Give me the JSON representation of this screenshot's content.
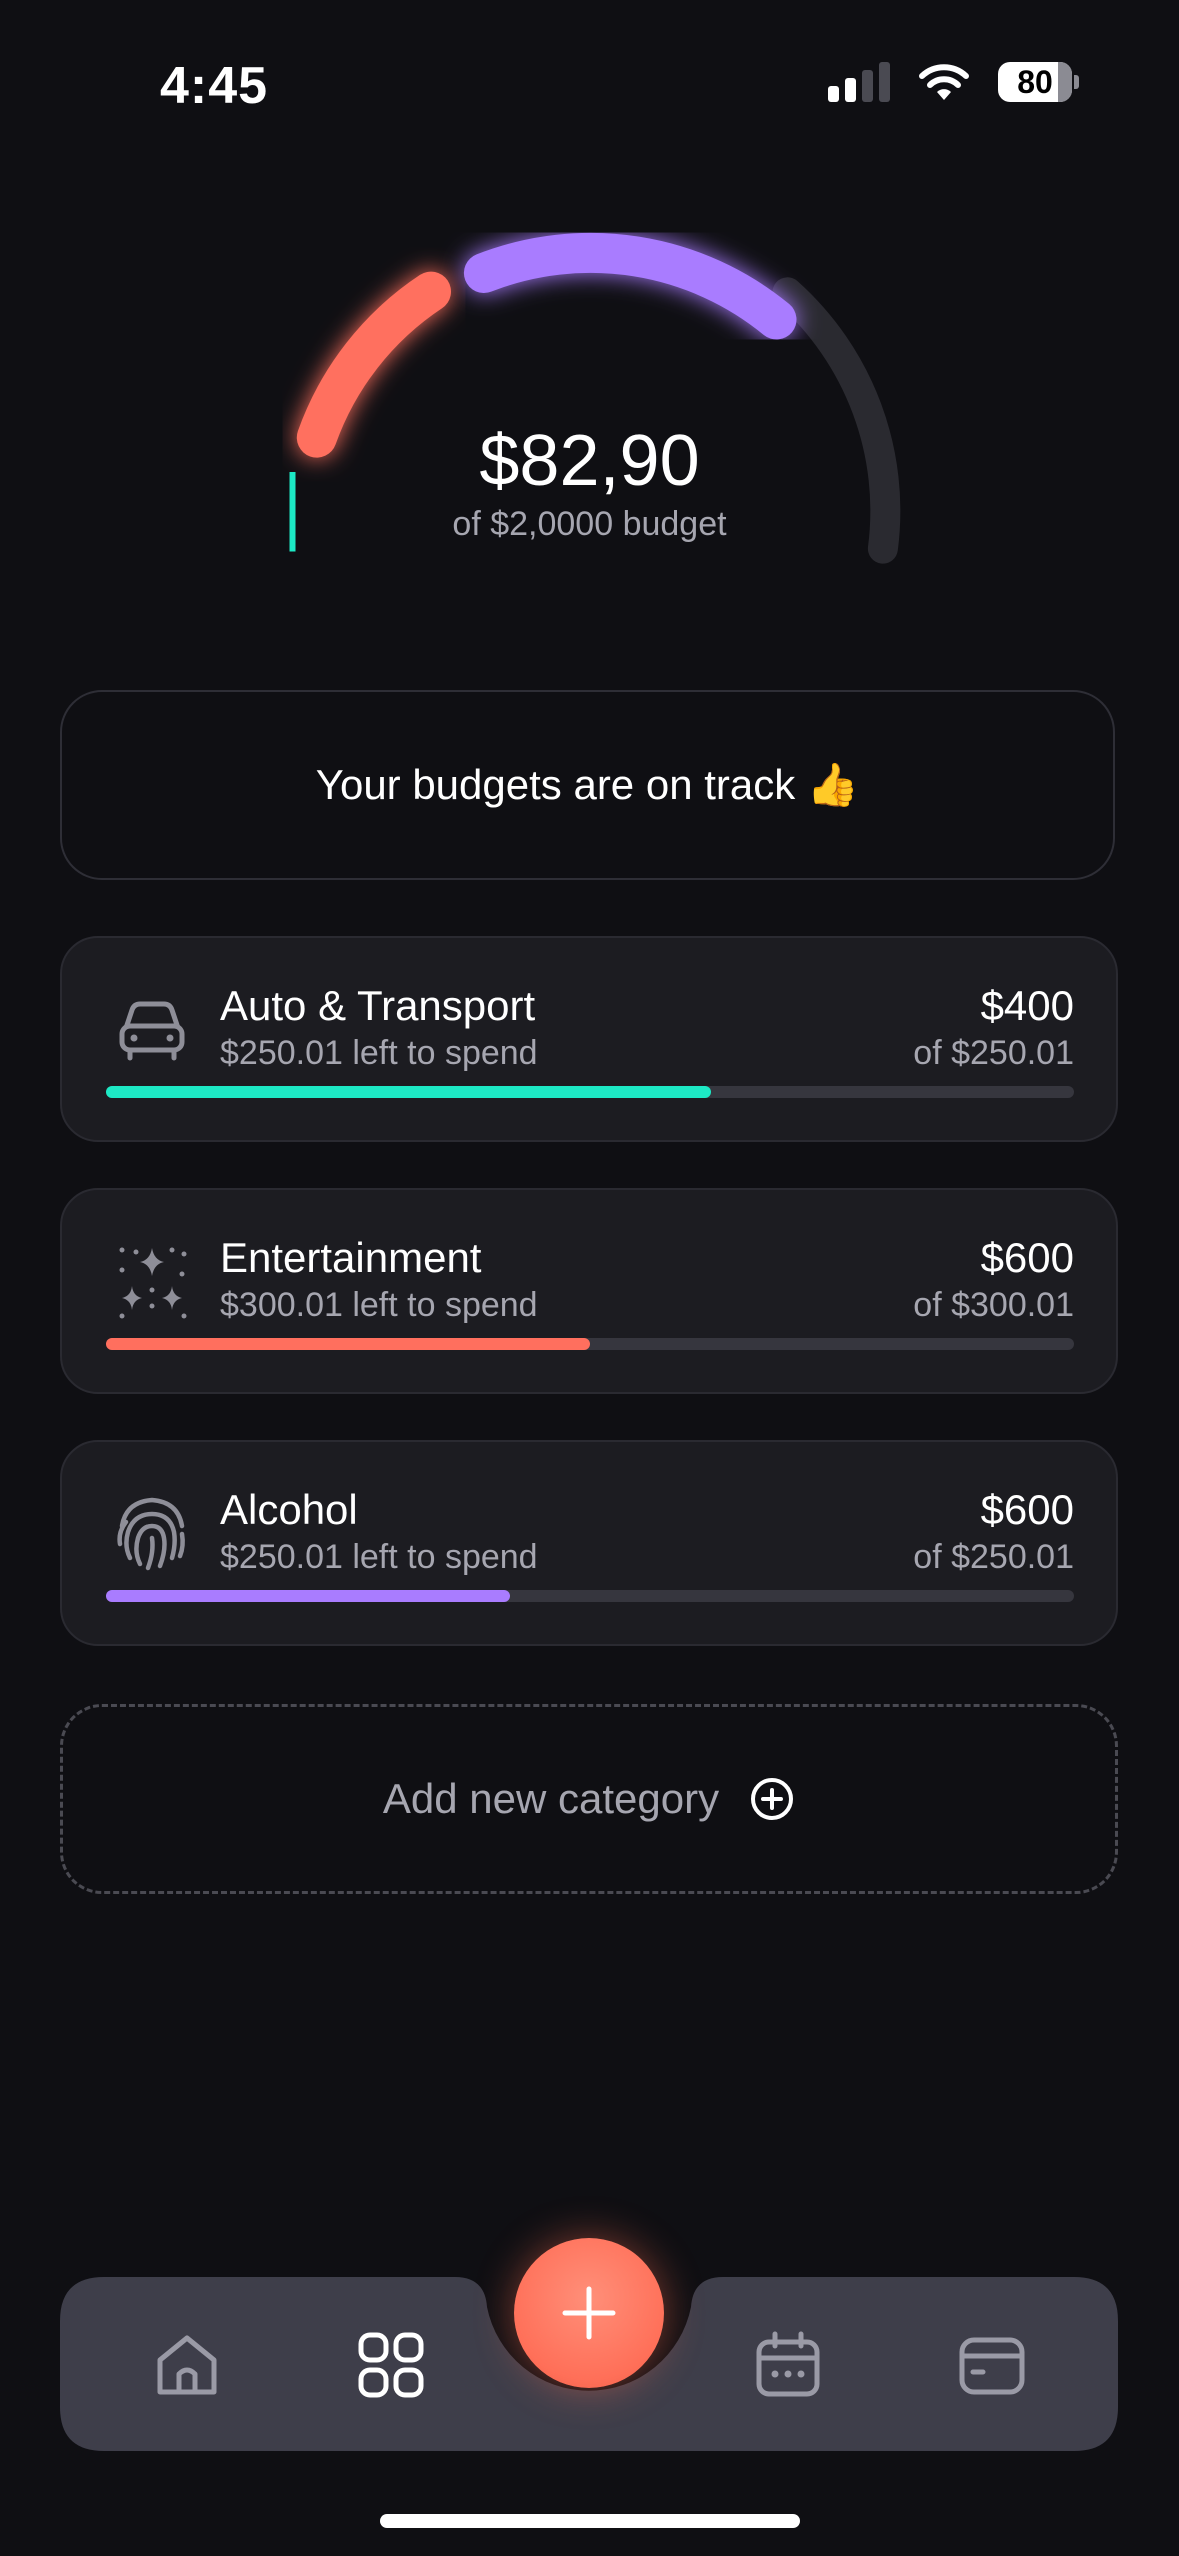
{
  "status_bar": {
    "time": "4:45",
    "battery": "80"
  },
  "summary": {
    "amount": "$82,90",
    "budget_text": "of $2,0000 budget",
    "segments": [
      {
        "name": "Auto & Transport",
        "color": "#1de9c5"
      },
      {
        "name": "Entertainment",
        "color": "#ff6f5e"
      },
      {
        "name": "Alcohol",
        "color": "#a97cff"
      }
    ],
    "track_color": "#2a2a30"
  },
  "banner": {
    "text": "Your budgets are on track 👍"
  },
  "categories": [
    {
      "name": "Auto & Transport",
      "left": "$250.01 left to spend",
      "amount": "$400",
      "of": "of $250.01",
      "progress": 0.625,
      "color": "#1de9c5",
      "icon": "car-icon"
    },
    {
      "name": "Entertainment",
      "left": "$300.01 left to spend",
      "amount": "$600",
      "of": "of $300.01",
      "progress": 0.5,
      "color": "#ff6f5e",
      "icon": "sparkles-icon"
    },
    {
      "name": "Alcohol",
      "left": "$250.01 left to spend",
      "amount": "$600",
      "of": "of $250.01",
      "progress": 0.417,
      "color": "#a97cff",
      "icon": "fingerprint-icon"
    }
  ],
  "add_category": {
    "label": "Add new category"
  },
  "nav": {
    "items": [
      "home-icon",
      "grid-icon",
      "calendar-icon",
      "card-icon"
    ],
    "active": "grid-icon"
  }
}
